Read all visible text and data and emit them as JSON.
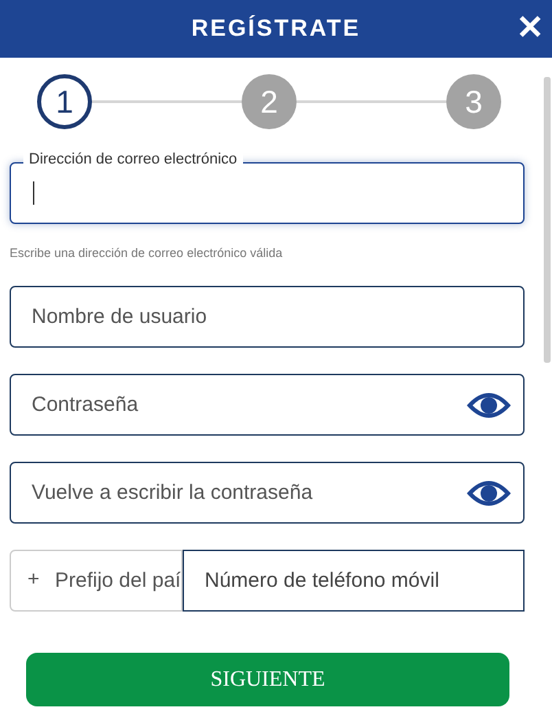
{
  "window": {
    "title": "REGÍSTRATE",
    "close": "✕"
  },
  "steps": [
    {
      "label": "1",
      "selected": true
    },
    {
      "label": "2",
      "selected": false
    },
    {
      "label": "3",
      "selected": false
    }
  ],
  "fields": [
    {
      "kind": "email",
      "label": "Dirección de correo electrónico",
      "focused": true,
      "hint": "Escribe una dirección de correo electrónico válida"
    },
    {
      "kind": "text",
      "placeholder": "Nombre de usuario"
    },
    {
      "kind": "password",
      "placeholder": "Contraseña"
    },
    {
      "kind": "password",
      "placeholder": "Vuelve a escribir la contraseña"
    },
    {
      "kind": "phone",
      "prefix_sign": "+",
      "prefix_placeholder": "Prefijo del paí",
      "placeholder": "Número de teléfono móvil"
    }
  ],
  "button": "SIGUIENTE"
}
